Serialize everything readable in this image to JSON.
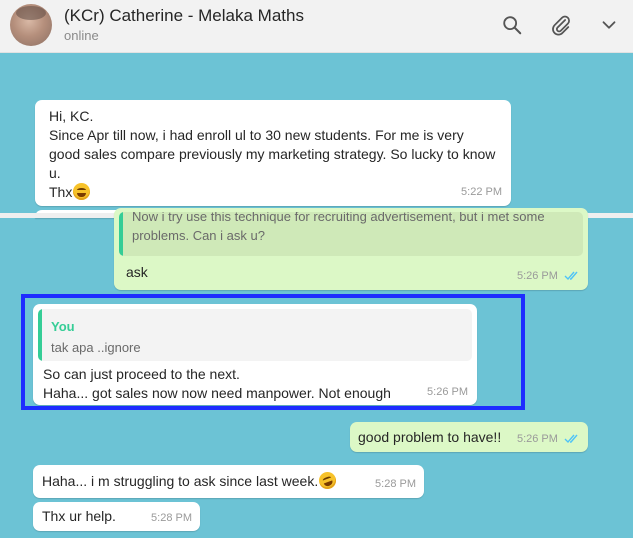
{
  "header": {
    "contact_name": "(KCr) Catherine - Melaka Maths",
    "status": "online",
    "icons": [
      "search-icon",
      "attach-icon",
      "chevron-down-icon"
    ]
  },
  "messages": [
    {
      "direction": "incoming",
      "text": "Hi, KC.\nSince Apr till now, i had enroll ul to 30 new students. For me is very\ngood sales compare previously my marketing strategy. So lucky to know\nu.\nThx",
      "emoji": "grinning-face",
      "time": "5:22 PM"
    },
    {
      "direction": "outgoing",
      "quote_text": "Now i try use this technique for recruiting advertisement, but i met some\nproblems. Can i ask u?",
      "text": "ask",
      "time": "5:26 PM",
      "read": true
    },
    {
      "direction": "incoming",
      "quote_author": "You",
      "quote_text": "tak apa ..ignore",
      "text": "So can just proceed to the next.\nHaha... got sales now now need manpower. Not enough",
      "time": "5:26 PM",
      "highlighted": true
    },
    {
      "direction": "outgoing",
      "text": "good problem to have!!",
      "time": "5:26 PM",
      "read": true
    },
    {
      "direction": "incoming",
      "text": "Haha... i m struggling to ask since last week.",
      "emoji": "rolling-laughing-face",
      "time": "5:28 PM"
    },
    {
      "direction": "incoming",
      "text": "Thx ur help.",
      "time": "5:28 PM"
    }
  ],
  "colors": {
    "chat_background": "#6cc3d5",
    "incoming_bubble": "#ffffff",
    "outgoing_bubble": "#dcf8c6",
    "read_ticks": "#4fc3f7",
    "quote_author": "#35cd96",
    "highlight_box": "#1e2cff"
  }
}
